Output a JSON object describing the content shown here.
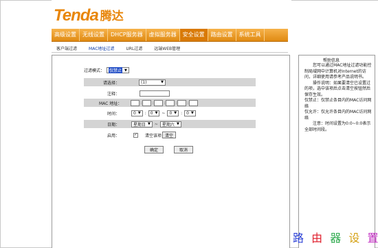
{
  "logo": {
    "latin": "Tenda",
    "chinese": "腾达"
  },
  "nav": {
    "items": [
      {
        "label": "高级设置",
        "active": false
      },
      {
        "label": "无线设置",
        "active": false
      },
      {
        "label": "DHCP服务器",
        "active": false
      },
      {
        "label": "虚拟服务器",
        "active": false
      },
      {
        "label": "安全设置",
        "active": true
      },
      {
        "label": "路由设置",
        "active": false
      },
      {
        "label": "系统工具",
        "active": false
      }
    ]
  },
  "subnav": {
    "items": [
      {
        "label": "客户端过滤",
        "active": false
      },
      {
        "label": "MAC地址过滤",
        "active": true
      },
      {
        "label": "URL过滤",
        "active": false
      },
      {
        "label": "远端WEB管理",
        "active": false
      }
    ]
  },
  "form": {
    "mode_label": "过滤模式：",
    "mode_value": "仅禁止",
    "select_label": "请选择：",
    "select_value": "(1)",
    "note_label": "注释：",
    "note_value": "",
    "mac_label": "MAC 地址：",
    "time_label": "时间：",
    "time_values": [
      "0",
      "0",
      "0",
      "0"
    ],
    "time_separator": "~",
    "date_label": "日期：",
    "date_from": "星期日",
    "date_to": "星期六",
    "date_separator": "~",
    "enable_label": "启用：",
    "enable_checked": "✓",
    "clear_label": "清空该项",
    "clear_button": "清空",
    "ok_button": "确定",
    "cancel_button": "取消"
  },
  "help": {
    "title": "帮助信息",
    "lines": [
      "　　您可以通过MAC地址过滤功能控制局域网中计算机对Internet的访问，详细使用请参考产品说明书。",
      "　　操作说明：如果要清空已设置过的项，选中该项后点击清空按钮然后保存生效。",
      "仅禁止：仅禁止条目内的MAC访问网络",
      "仅允许：仅允许条目内的MAC访问网络",
      "　　注意：时间设置为0:0~0:0表示全部时间段。"
    ]
  },
  "watermark": {
    "chars": [
      "路",
      "由",
      "器",
      "设",
      "置"
    ],
    "colors": [
      "#2a3fd6",
      "#e0222f",
      "#2aa84a",
      "#d4a012",
      "#c22dc2"
    ]
  }
}
